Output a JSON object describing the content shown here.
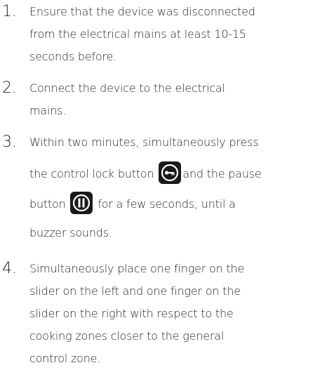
{
  "steps": [
    {
      "number": "1.",
      "lines": [
        "Ensure that the device was disconnected",
        "from the electrical mains at least 10-15",
        "seconds before."
      ]
    },
    {
      "number": "2.",
      "lines": [
        "Connect the device to the electrical",
        "mains."
      ]
    },
    {
      "number": "3.",
      "line1": "Within two minutes, simultaneously press",
      "line2_before": "the control lock button",
      "line2_after": "and the pause",
      "line3_before": "button",
      "line3_after": "for a few seconds, until a",
      "line4": "buzzer sounds.",
      "icons": [
        "control-lock-key-icon",
        "pause-icon"
      ]
    },
    {
      "number": "4.",
      "lines": [
        "Simultaneously place one finger on the",
        "slider on the left and one finger on the",
        "slider on the right with respect to the",
        "cooking zones closer to the general",
        "control zone."
      ]
    }
  ],
  "colors": {
    "text": "#231f20",
    "icon_background": "#1a1a1a",
    "icon_foreground": "#ffffff"
  }
}
